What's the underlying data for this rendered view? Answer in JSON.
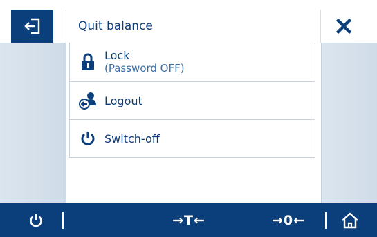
{
  "header": {
    "back_icon": "exit-icon",
    "title": "Quit balance",
    "close_icon": "close-icon"
  },
  "menu": {
    "items": [
      {
        "label": "Lock",
        "sublabel": "(Password OFF)",
        "icon": "lock-icon"
      },
      {
        "label": "Logout",
        "icon": "logout-user-icon"
      },
      {
        "label": "Switch-off",
        "icon": "power-icon"
      }
    ]
  },
  "footer": {
    "power_icon": "power-icon",
    "tare_label": "→T←",
    "zero_label": "→0←",
    "home_icon": "home-icon"
  },
  "colors": {
    "brand": "#0b3f7c",
    "sublabel": "#3d6ea5",
    "side_bg": "#dbe5ef"
  }
}
